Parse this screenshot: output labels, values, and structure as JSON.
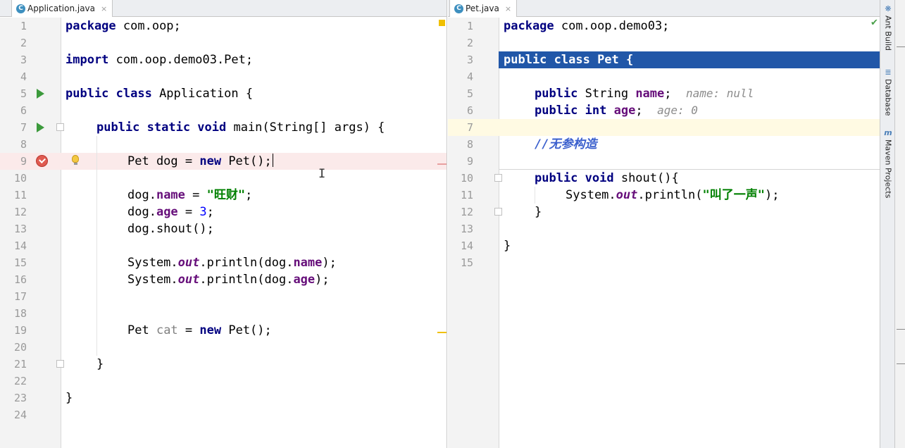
{
  "left_editor": {
    "tab": {
      "label": "Application.java",
      "icon": "C",
      "close": "×"
    },
    "line_numbers": [
      "1",
      "2",
      "3",
      "4",
      "5",
      "6",
      "7",
      "8",
      "9",
      "10",
      "11",
      "12",
      "13",
      "14",
      "15",
      "16",
      "17",
      "18",
      "19",
      "20",
      "21",
      "22",
      "23",
      "24"
    ],
    "code": {
      "l1_kw": "package",
      "l1_rest": " com.oop;",
      "l3_kw": "import",
      "l3_rest": " com.oop.demo03.Pet;",
      "l5_kw": "public class",
      "l5_rest": " Application {",
      "l7_kw": "public static void",
      "l7_rest": " main(String[] args) {",
      "l9_a": "Pet dog = ",
      "l9_kw": "new",
      "l9_b": " Pet();",
      "l11_a": "dog.",
      "l11_fld": "name",
      "l11_b": " = ",
      "l11_str": "\"旺财\"",
      "l11_c": ";",
      "l12_a": "dog.",
      "l12_fld": "age",
      "l12_b": " = ",
      "l12_num": "3",
      "l12_c": ";",
      "l13": "dog.shout();",
      "l15_a": "System.",
      "l15_stat": "out",
      "l15_b": ".println(dog.",
      "l15_fld": "name",
      "l15_c": ");",
      "l16_a": "System.",
      "l16_stat": "out",
      "l16_b": ".println(dog.",
      "l16_fld": "age",
      "l16_c": ");",
      "l19_a": "Pet ",
      "l19_unused": "cat",
      "l19_b": " = ",
      "l19_kw": "new",
      "l19_c": " Pet();",
      "l21": "}",
      "l23": "}"
    }
  },
  "right_editor": {
    "tab": {
      "label": "Pet.java",
      "icon": "C",
      "close": "×"
    },
    "line_numbers": [
      "1",
      "2",
      "3",
      "4",
      "5",
      "6",
      "7",
      "8",
      "9",
      "10",
      "11",
      "12",
      "13",
      "14",
      "15"
    ],
    "code": {
      "l1_kw": "package",
      "l1_rest": " com.oop.demo03;",
      "l3_kw": "public class",
      "l3_rest": " Pet {",
      "l5_kw": "public",
      "l5_a": " String ",
      "l5_fld": "name",
      "l5_b": ";",
      "l5_hint": "name: null",
      "l6_kw": "public int",
      "l6_a": " ",
      "l6_fld": "age",
      "l6_b": ";",
      "l6_hint": "age: 0",
      "l8_cmt": "//无参构造",
      "l10_kw": "public void",
      "l10_rest": " shout(){",
      "l11_a": "System.",
      "l11_stat": "out",
      "l11_b": ".println(",
      "l11_str": "\"叫了一声\"",
      "l11_c": ");",
      "l12": "}",
      "l14": "}"
    }
  },
  "tool_window_strip": {
    "items": [
      {
        "label": "Ant Build",
        "icon": "ant-icon"
      },
      {
        "label": "Database",
        "icon": "database-icon"
      },
      {
        "label": "Maven Projects",
        "icon": "maven-icon"
      }
    ]
  },
  "colors": {
    "keyword": "#000080",
    "string": "#008000",
    "field": "#660e7a",
    "comment": "#3a5fcd",
    "selection": "#2157a8",
    "breakpoint": "#e05a50",
    "run_arrow": "#3c9a3c"
  }
}
